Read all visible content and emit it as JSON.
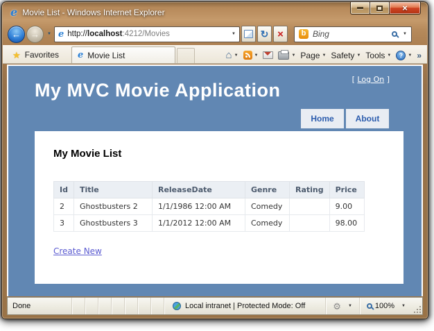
{
  "titlebar": {
    "title": "Movie List - Windows Internet Explorer"
  },
  "nav": {
    "url_protocol": "http://",
    "url_host": "localhost",
    "url_path": ":4212/Movies",
    "search_placeholder": "Bing"
  },
  "favorites_bar": {
    "favorites_label": "Favorites",
    "tab_title": "Movie List"
  },
  "command_bar": {
    "page_label": "Page",
    "safety_label": "Safety",
    "tools_label": "Tools"
  },
  "page": {
    "logon_prefix": "[",
    "logon_link": "Log On",
    "logon_suffix": "]",
    "title": "My MVC Movie Application",
    "nav_home": "Home",
    "nav_about": "About",
    "heading": "My Movie List",
    "table": {
      "columns": [
        "Id",
        "Title",
        "ReleaseDate",
        "Genre",
        "Rating",
        "Price"
      ],
      "rows": [
        [
          "2",
          "Ghostbusters 2",
          "1/1/1986 12:00 AM",
          "Comedy",
          "",
          "9.00"
        ],
        [
          "3",
          "Ghostbusters 3",
          "1/1/2012 12:00 AM",
          "Comedy",
          "",
          "98.00"
        ]
      ]
    },
    "create_new": "Create New"
  },
  "statusbar": {
    "status": "Done",
    "zone": "Local intranet | Protected Mode: Off",
    "zoom_level": "100%"
  },
  "icons": {
    "ie_logo": "e",
    "back_arrow": "←",
    "forward_arrow": "→",
    "chevron_down": "▼",
    "refresh": "↻",
    "stop": "×",
    "bing_logo": "b",
    "star": "★",
    "home": "⌂",
    "help": "?",
    "double_chevron": "»",
    "gear": "⚙",
    "close": "×"
  },
  "colors": {
    "page_background": "#6187b3",
    "frame_brown": "#a87c4e",
    "menu_text": "#2b5cad",
    "link_create_new": "#5b5bd1",
    "close_button_red": "#cf4423"
  }
}
